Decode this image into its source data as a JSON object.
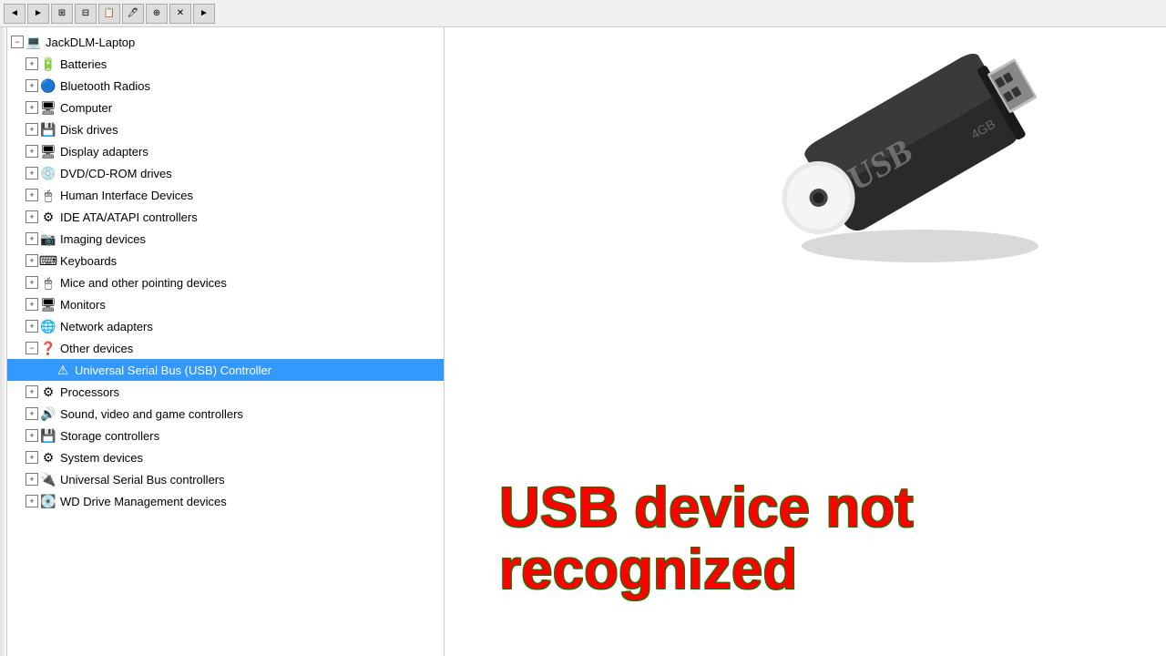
{
  "toolbar": {
    "buttons": [
      "◄",
      "►",
      "⊞",
      "⊟",
      "📋",
      "🖊",
      "⊕",
      "✕",
      "►"
    ]
  },
  "tree": {
    "root": "JackDLM-Laptop",
    "items": [
      {
        "id": "root",
        "label": "JackDLM-Laptop",
        "indent": 0,
        "icon": "💻",
        "expand": "open",
        "selected": false
      },
      {
        "id": "batteries",
        "label": "Batteries",
        "indent": 1,
        "icon": "🔋",
        "expand": "closed",
        "selected": false
      },
      {
        "id": "bluetooth",
        "label": "Bluetooth Radios",
        "indent": 1,
        "icon": "🔵",
        "expand": "closed",
        "selected": false
      },
      {
        "id": "computer",
        "label": "Computer",
        "indent": 1,
        "icon": "🖥",
        "expand": "closed",
        "selected": false
      },
      {
        "id": "disk",
        "label": "Disk drives",
        "indent": 1,
        "icon": "💾",
        "expand": "closed",
        "selected": false
      },
      {
        "id": "display",
        "label": "Display adapters",
        "indent": 1,
        "icon": "🖥",
        "expand": "closed",
        "selected": false
      },
      {
        "id": "dvd",
        "label": "DVD/CD-ROM drives",
        "indent": 1,
        "icon": "💿",
        "expand": "closed",
        "selected": false
      },
      {
        "id": "hid",
        "label": "Human Interface Devices",
        "indent": 1,
        "icon": "🖱",
        "expand": "closed",
        "selected": false
      },
      {
        "id": "ide",
        "label": "IDE ATA/ATAPI controllers",
        "indent": 1,
        "icon": "⚙",
        "expand": "closed",
        "selected": false
      },
      {
        "id": "imaging",
        "label": "Imaging devices",
        "indent": 1,
        "icon": "📷",
        "expand": "closed",
        "selected": false
      },
      {
        "id": "keyboards",
        "label": "Keyboards",
        "indent": 1,
        "icon": "⌨",
        "expand": "closed",
        "selected": false
      },
      {
        "id": "mice",
        "label": "Mice and other pointing devices",
        "indent": 1,
        "icon": "🖱",
        "expand": "closed",
        "selected": false
      },
      {
        "id": "monitors",
        "label": "Monitors",
        "indent": 1,
        "icon": "🖥",
        "expand": "closed",
        "selected": false
      },
      {
        "id": "network",
        "label": "Network adapters",
        "indent": 1,
        "icon": "🌐",
        "expand": "closed",
        "selected": false
      },
      {
        "id": "other",
        "label": "Other devices",
        "indent": 1,
        "icon": "❓",
        "expand": "open",
        "selected": false
      },
      {
        "id": "usb-controller",
        "label": "Universal Serial Bus (USB) Controller",
        "indent": 2,
        "icon": "⚠",
        "expand": "none",
        "selected": true
      },
      {
        "id": "processors",
        "label": "Processors",
        "indent": 1,
        "icon": "⚙",
        "expand": "closed",
        "selected": false
      },
      {
        "id": "sound",
        "label": "Sound, video and game controllers",
        "indent": 1,
        "icon": "🔊",
        "expand": "closed",
        "selected": false
      },
      {
        "id": "storage",
        "label": "Storage controllers",
        "indent": 1,
        "icon": "💾",
        "expand": "closed",
        "selected": false
      },
      {
        "id": "system",
        "label": "System devices",
        "indent": 1,
        "icon": "⚙",
        "expand": "closed",
        "selected": false
      },
      {
        "id": "usb",
        "label": "Universal Serial Bus controllers",
        "indent": 1,
        "icon": "🔌",
        "expand": "closed",
        "selected": false
      },
      {
        "id": "wd",
        "label": "WD Drive Management devices",
        "indent": 1,
        "icon": "💽",
        "expand": "closed",
        "selected": false
      }
    ]
  },
  "error_text": {
    "line1": "USB device not",
    "line2": "recognized"
  },
  "colors": {
    "error_red": "#ff0000",
    "error_outline": "#008000",
    "selected_bg": "#3399ff"
  }
}
